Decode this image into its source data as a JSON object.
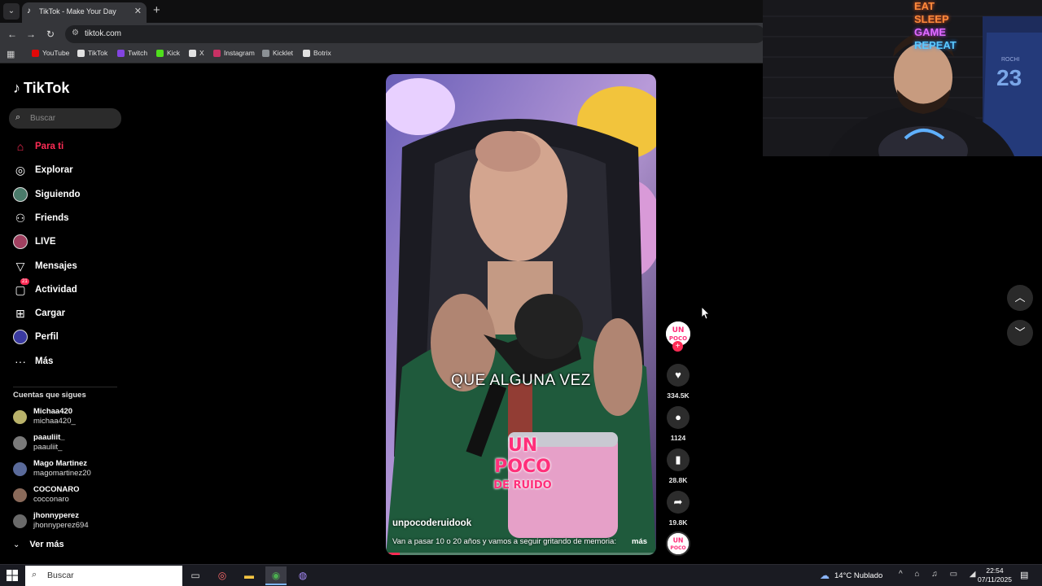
{
  "browser": {
    "tab": {
      "title": "TikTok - Make Your Day",
      "favicon": "tiktok-icon"
    },
    "url": "tiktok.com",
    "bookmarks": [
      {
        "label": "YouTube",
        "icon": "youtube-icon",
        "color": "#ff0000"
      },
      {
        "label": "TikTok",
        "icon": "tiktok-icon",
        "color": "#ffffff"
      },
      {
        "label": "Twitch",
        "icon": "twitch-icon",
        "color": "#9146ff"
      },
      {
        "label": "Kick",
        "icon": "kick-icon",
        "color": "#53fc18"
      },
      {
        "label": "X",
        "icon": "x-icon",
        "color": "#ffffff"
      },
      {
        "label": "Instagram",
        "icon": "instagram-icon",
        "color": "#e1306c"
      },
      {
        "label": "Kicklet",
        "icon": "kicklet-icon",
        "color": "#9aa0a6"
      },
      {
        "label": "Botrix",
        "icon": "botrix-icon",
        "color": "#ffffff"
      }
    ]
  },
  "sidebar": {
    "logo": "TikTok",
    "search_placeholder": "Buscar",
    "nav": [
      {
        "label": "Para ti",
        "icon": "home-icon",
        "active": true
      },
      {
        "label": "Explorar",
        "icon": "compass-icon"
      },
      {
        "label": "Siguiendo",
        "icon": "following-avatar-icon"
      },
      {
        "label": "Friends",
        "icon": "friends-icon"
      },
      {
        "label": "LIVE",
        "icon": "live-avatar-icon"
      },
      {
        "label": "Mensajes",
        "icon": "send-icon"
      },
      {
        "label": "Actividad",
        "icon": "inbox-icon",
        "badge": "21"
      },
      {
        "label": "Cargar",
        "icon": "upload-icon"
      },
      {
        "label": "Perfil",
        "icon": "profile-avatar-icon"
      },
      {
        "label": "Más",
        "icon": "more-dots-icon"
      }
    ],
    "following_title": "Cuentas que sigues",
    "accounts": [
      {
        "name": "Michaa420",
        "username": "michaa420_"
      },
      {
        "name": "paauliit_",
        "username": "paauliit_"
      },
      {
        "name": "Mago Martinez",
        "username": "magomartinez20"
      },
      {
        "name": "COCONARO",
        "username": "cocconaro"
      },
      {
        "name": "jhonnyperez",
        "username": "jhonnyperez694"
      }
    ],
    "see_more": "Ver más"
  },
  "video": {
    "caption": "QUE ALGUNA VEZ",
    "overlay_logo": [
      "UN",
      "POCO",
      "DE RUIDO"
    ],
    "author": "unpocoderuidook",
    "description": "Van a pasar 10 o 20 años y vamos a seguir gritando de memoria:",
    "more": "más",
    "progress": 0.05
  },
  "actions": {
    "likes": "334.5K",
    "comments": "1124",
    "saves": "28.8K",
    "shares": "19.8K"
  },
  "webcam": {
    "neon": [
      "EAT",
      "SLEEP",
      "GAME",
      "REPEAT"
    ],
    "jersey_name": "ROCHI",
    "jersey_number": "23"
  },
  "taskbar": {
    "search": "Buscar",
    "weather": "14°C  Nublado",
    "time": "22:54",
    "date": "07/11/2025"
  },
  "colors": {
    "accent": "#fe2c55",
    "background": "#000000"
  }
}
